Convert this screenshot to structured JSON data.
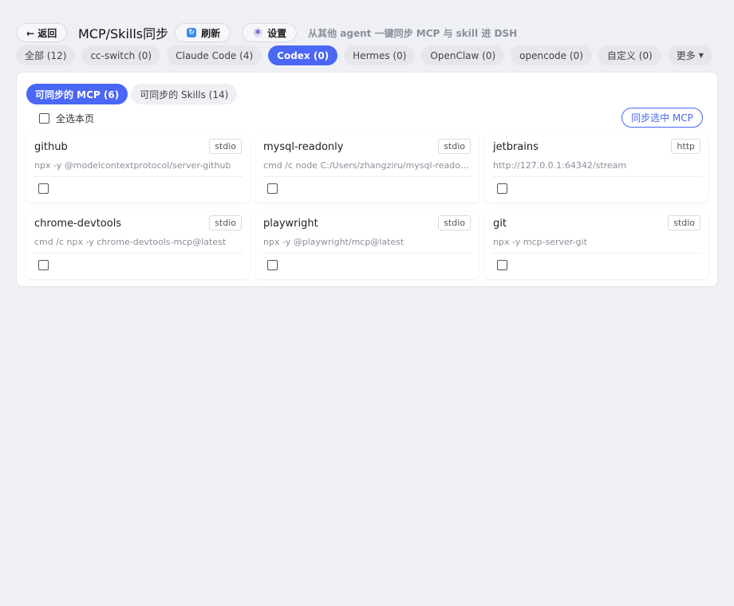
{
  "header": {
    "back_label": "← 返回",
    "title": "MCP/Skills同步",
    "refresh_label": "刷新",
    "settings_label": "设置",
    "subtitle": "从其他 agent 一键同步 MCP 与 skill 进 DSH"
  },
  "filters": [
    {
      "label": "全部 (12)",
      "active": false
    },
    {
      "label": "cc-switch (0)",
      "active": false
    },
    {
      "label": "Claude Code (4)",
      "active": false
    },
    {
      "label": "Codex (0)",
      "active": true
    },
    {
      "label": "Hermes (0)",
      "active": false
    },
    {
      "label": "OpenClaw (0)",
      "active": false
    },
    {
      "label": "opencode (0)",
      "active": false
    },
    {
      "label": "自定义 (0)",
      "active": false
    },
    {
      "label": "更多",
      "active": false
    }
  ],
  "subtabs": [
    {
      "label": "可同步的 MCP (6)",
      "active": true
    },
    {
      "label": "可同步的 Skills (14)",
      "active": false
    }
  ],
  "select_all_label": "全选本页",
  "sync_button_label": "同步选中 MCP",
  "cards": [
    {
      "name": "github",
      "type": "stdio",
      "cmd": "npx -y @modelcontextprotocol/server-github",
      "checked": false
    },
    {
      "name": "mysql-readonly",
      "type": "stdio",
      "cmd": "cmd /c node C:/Users/zhangziru/mysql-readonly-mcp/index.js",
      "checked": false
    },
    {
      "name": "jetbrains",
      "type": "http",
      "cmd": "http://127.0.0.1:64342/stream",
      "checked": false
    },
    {
      "name": "chrome-devtools",
      "type": "stdio",
      "cmd": "cmd /c npx -y chrome-devtools-mcp@latest",
      "checked": false
    },
    {
      "name": "playwright",
      "type": "stdio",
      "cmd": "npx -y @playwright/mcp@latest",
      "checked": false
    },
    {
      "name": "git",
      "type": "stdio",
      "cmd": "npx -y mcp-server-git",
      "checked": false
    }
  ]
}
